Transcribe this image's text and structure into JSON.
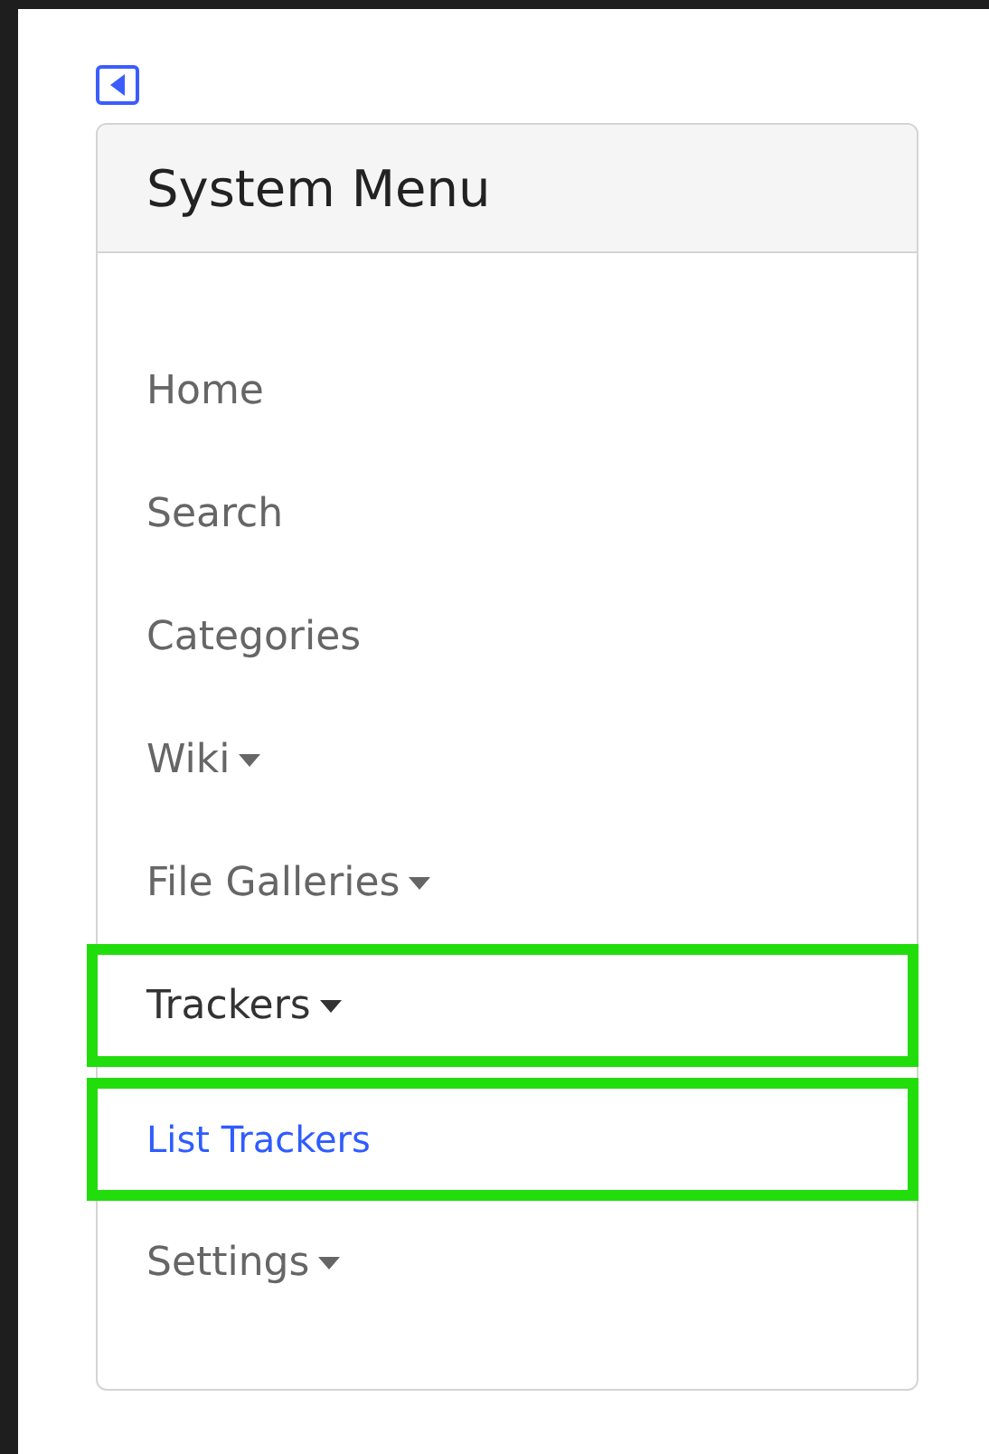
{
  "sidebar_toggle": {
    "kind": "collapse"
  },
  "menu": {
    "title": "System Menu",
    "items": [
      {
        "label": "Home",
        "kind": "link",
        "highlighted": false
      },
      {
        "label": "Search",
        "kind": "link",
        "highlighted": false
      },
      {
        "label": "Categories",
        "kind": "link",
        "highlighted": false
      },
      {
        "label": "Wiki",
        "kind": "menu",
        "expanded": false,
        "highlighted": false
      },
      {
        "label": "File Galleries",
        "kind": "menu",
        "expanded": false,
        "highlighted": false
      },
      {
        "label": "Trackers",
        "kind": "menu",
        "expanded": true,
        "highlighted": true,
        "children": [
          {
            "label": "List Trackers",
            "highlighted": true
          }
        ]
      },
      {
        "label": "Settings",
        "kind": "menu",
        "expanded": false,
        "highlighted": false
      }
    ]
  }
}
